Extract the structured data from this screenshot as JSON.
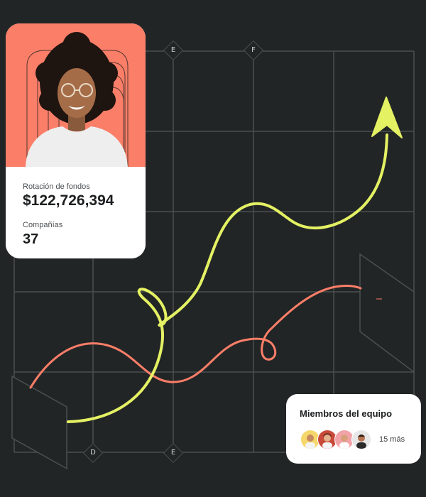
{
  "profile_card": {
    "turnover_label": "Rotación de fondos",
    "turnover_value": "$122,726,394",
    "companies_label": "Compañías",
    "companies_value": "37"
  },
  "team_card": {
    "title": "Miembros del equipo",
    "more_label": "15 más",
    "avatars": [
      "avatar-1",
      "avatar-2",
      "avatar-3",
      "avatar-4"
    ]
  },
  "grid_markers": {
    "top_left": "E",
    "top_right": "F",
    "bottom_left": "D",
    "bottom_right": "E"
  },
  "colors": {
    "background": "#222526",
    "grid_line": "#4a4f4f",
    "accent_coral": "#fb7e68",
    "accent_lime": "#e4f163",
    "card": "#ffffff"
  }
}
